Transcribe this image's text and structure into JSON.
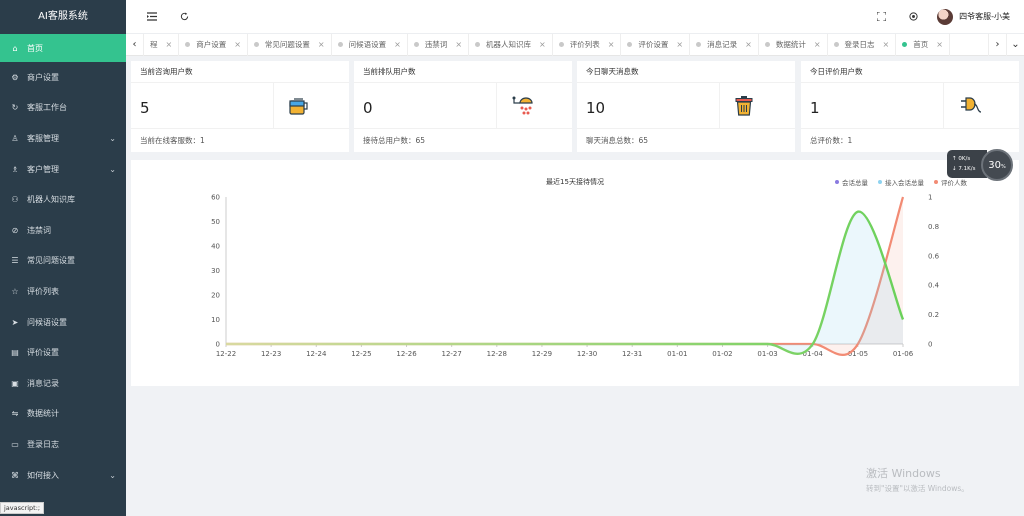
{
  "app": {
    "brand": "AI客服系统"
  },
  "sidebar": {
    "items": [
      {
        "label": "首页",
        "icon": "home-icon",
        "active": true,
        "expandable": false
      },
      {
        "label": "商户设置",
        "icon": "gear-icon",
        "active": false,
        "expandable": false
      },
      {
        "label": "客服工作台",
        "icon": "refresh-icon",
        "active": false,
        "expandable": false
      },
      {
        "label": "客服管理",
        "icon": "user-icon",
        "active": false,
        "expandable": true
      },
      {
        "label": "客户管理",
        "icon": "user-group-icon",
        "active": false,
        "expandable": true
      },
      {
        "label": "机器人知识库",
        "icon": "robot-icon",
        "active": false,
        "expandable": false
      },
      {
        "label": "违禁词",
        "icon": "ban-icon",
        "active": false,
        "expandable": false
      },
      {
        "label": "常见问题设置",
        "icon": "question-icon",
        "active": false,
        "expandable": false
      },
      {
        "label": "评价列表",
        "icon": "star-icon",
        "active": false,
        "expandable": false
      },
      {
        "label": "问候语设置",
        "icon": "send-icon",
        "active": false,
        "expandable": false
      },
      {
        "label": "评价设置",
        "icon": "form-icon",
        "active": false,
        "expandable": false
      },
      {
        "label": "消息记录",
        "icon": "message-icon",
        "active": false,
        "expandable": false
      },
      {
        "label": "数据统计",
        "icon": "stats-icon",
        "active": false,
        "expandable": false
      },
      {
        "label": "登录日志",
        "icon": "log-icon",
        "active": false,
        "expandable": false
      },
      {
        "label": "如何接入",
        "icon": "link-icon",
        "active": false,
        "expandable": true
      }
    ]
  },
  "header": {
    "user_name": "四爷客服-小美"
  },
  "tabs": [
    {
      "label": "程",
      "active": false,
      "show_dot": false
    },
    {
      "label": "商户设置",
      "active": false,
      "show_dot": true
    },
    {
      "label": "常见问题设置",
      "active": false,
      "show_dot": true
    },
    {
      "label": "问候语设置",
      "active": false,
      "show_dot": true
    },
    {
      "label": "违禁词",
      "active": false,
      "show_dot": true
    },
    {
      "label": "机器人知识库",
      "active": false,
      "show_dot": true
    },
    {
      "label": "评价列表",
      "active": false,
      "show_dot": true
    },
    {
      "label": "评价设置",
      "active": false,
      "show_dot": true
    },
    {
      "label": "消息记录",
      "active": false,
      "show_dot": true
    },
    {
      "label": "数据统计",
      "active": false,
      "show_dot": true
    },
    {
      "label": "登录日志",
      "active": false,
      "show_dot": true
    },
    {
      "label": "首页",
      "active": true,
      "show_dot": true
    }
  ],
  "cards": [
    {
      "title": "当前咨询用户数",
      "value": "5",
      "foot": "当前在线客服数：1",
      "icon": "paint-bucket-icon"
    },
    {
      "title": "当前排队用户数",
      "value": "0",
      "foot": "接待总用户数：65",
      "icon": "shower-icon"
    },
    {
      "title": "今日聊天消息数",
      "value": "10",
      "foot": "聊天消息总数：65",
      "icon": "trash-can-icon"
    },
    {
      "title": "今日评价用户数",
      "value": "1",
      "foot": "总评价数：1",
      "icon": "plug-icon"
    }
  ],
  "speed": {
    "upload": "0",
    "upload_unit": "K/s",
    "download": "7.1",
    "download_unit": "K/s",
    "percent": "30",
    "percent_unit": "%"
  },
  "watermark": {
    "line1": "激活 Windows",
    "line2": "转到\"设置\"以激活 Windows。"
  },
  "status": "javascript:;",
  "chart_data": {
    "type": "line",
    "title": "最近15天接待情况",
    "categories": [
      "12-22",
      "12-23",
      "12-24",
      "12-25",
      "12-26",
      "12-27",
      "12-28",
      "12-29",
      "12-30",
      "12-31",
      "01-01",
      "01-02",
      "01-03",
      "01-04",
      "01-05",
      "01-06"
    ],
    "series": [
      {
        "name": "会话总量",
        "axis": "left",
        "color": "#8a7be0",
        "values": [
          0,
          0,
          0,
          0,
          0,
          0,
          0,
          0,
          0,
          0,
          0,
          0,
          0,
          0,
          54,
          10
        ]
      },
      {
        "name": "接入会话总量",
        "axis": "left",
        "color": "#8fd3f0",
        "values": [
          0,
          0,
          0,
          0,
          0,
          0,
          0,
          0,
          0,
          0,
          0,
          0,
          0,
          0,
          54,
          10
        ]
      },
      {
        "name": "评价人数",
        "axis": "right",
        "color": "#f28b74",
        "values": [
          0,
          0,
          0,
          0,
          0,
          0,
          0,
          0,
          0,
          0,
          0,
          0,
          0,
          0,
          0,
          1
        ]
      }
    ],
    "line_gradient": {
      "start": "#d9d9a0",
      "end": "#6ad15a"
    },
    "y_left": {
      "min": 0,
      "max": 60,
      "ticks": [
        0,
        10,
        20,
        30,
        40,
        50,
        60
      ]
    },
    "y_right": {
      "min": 0,
      "max": 1,
      "ticks": [
        "0",
        "0.2",
        "0.4",
        "0.6",
        "0.8",
        "1"
      ]
    },
    "legend_position": "top-right",
    "grid": false
  }
}
